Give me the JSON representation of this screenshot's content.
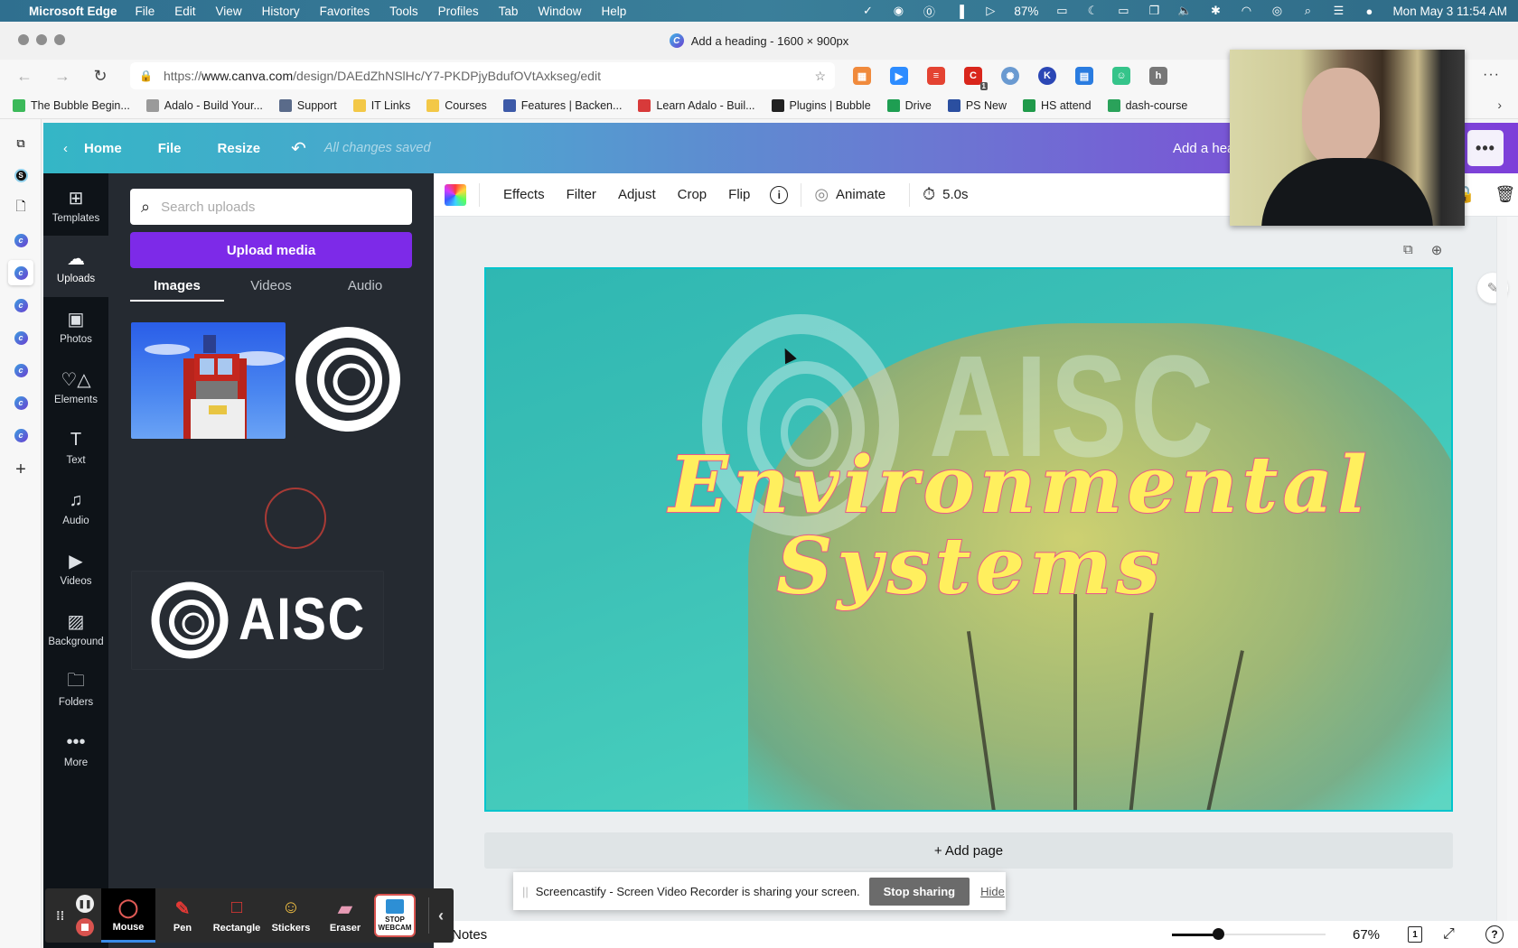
{
  "mac_menubar": {
    "app_name": "Microsoft Edge",
    "menus": [
      "File",
      "Edit",
      "View",
      "History",
      "Favorites",
      "Tools",
      "Profiles",
      "Tab",
      "Window",
      "Help"
    ],
    "battery": "87%",
    "clock": "Mon May 3  11:54 AM"
  },
  "window": {
    "title": "Add a heading - 1600 × 900px"
  },
  "browser": {
    "url_scheme": "https://",
    "url_host": "www.canva.com",
    "url_path": "/design/DAEdZhNSlHc/Y7-PKDPjyBdufOVtAxkseg/edit",
    "extension_badge": "1",
    "bookmarks": [
      {
        "label": "The Bubble Begin...",
        "color": "#3cb95a"
      },
      {
        "label": "Adalo - Build Your...",
        "color": "#9a9a9a"
      },
      {
        "label": "Support",
        "color": "#5a6b8a"
      },
      {
        "label": "IT Links",
        "color": "#f3c847"
      },
      {
        "label": "Courses",
        "color": "#f3c847"
      },
      {
        "label": "Features | Backen...",
        "color": "#3d5aa8"
      },
      {
        "label": "Learn Adalo - Buil...",
        "color": "#d83a3a"
      },
      {
        "label": "Plugins | Bubble",
        "color": "#222222"
      },
      {
        "label": "Drive",
        "color": "#1e9e52"
      },
      {
        "label": "PS New",
        "color": "#2b4fa0"
      },
      {
        "label": "HS attend",
        "color": "#1f9a4a"
      },
      {
        "label": "dash-course",
        "color": "#2aa25a"
      }
    ]
  },
  "canva_header": {
    "home": "Home",
    "file": "File",
    "resize": "Resize",
    "status": "All changes saved",
    "design_title": "Add a hea",
    "more": "•••"
  },
  "rail": {
    "items": [
      {
        "label": "Templates",
        "icon": "⊞"
      },
      {
        "label": "Uploads",
        "icon": "☁"
      },
      {
        "label": "Photos",
        "icon": "▣"
      },
      {
        "label": "Elements",
        "icon": "♡△"
      },
      {
        "label": "Text",
        "icon": "T"
      },
      {
        "label": "Audio",
        "icon": "♫"
      },
      {
        "label": "Videos",
        "icon": "▶"
      },
      {
        "label": "Background",
        "icon": "▨"
      },
      {
        "label": "Folders",
        "icon": "🗀"
      },
      {
        "label": "More",
        "icon": "•••"
      }
    ],
    "active": "Uploads"
  },
  "uploads_panel": {
    "search_placeholder": "Search uploads",
    "upload_button": "Upload media",
    "tabs": [
      "Images",
      "Videos",
      "Audio"
    ],
    "active_tab": "Images",
    "thumbnails": [
      "optimus-prime-image",
      "aisc-swirl-logo",
      "uploading-spinner",
      "aisc-logo-wordmark"
    ],
    "logo_text": "AISC"
  },
  "context_toolbar": {
    "buttons": [
      "Effects",
      "Filter",
      "Adjust",
      "Crop",
      "Flip"
    ],
    "animate": "Animate",
    "duration": "5.0s"
  },
  "design": {
    "heading_line1": "Environmental",
    "heading_line2": "Systems",
    "watermark_text": "AISC",
    "add_page": "+ Add page",
    "colors": {
      "heading_fill": "#ffef5e",
      "heading_stroke": "#e85c8a",
      "background": "#3cc0b6"
    }
  },
  "bottom_bar": {
    "notes": "Notes",
    "zoom_pct": "67%",
    "zoom_fraction": 0.3,
    "page_count": "1"
  },
  "share_banner": {
    "message": "Screencastify - Screen Video Recorder is sharing your screen.",
    "stop": "Stop sharing",
    "hide": "Hide"
  },
  "screencastify": {
    "tools": [
      {
        "label": "Mouse",
        "icon": "◯",
        "color": "#e05a55"
      },
      {
        "label": "Pen",
        "icon": "✎",
        "color": "#e53935"
      },
      {
        "label": "Rectangle",
        "icon": "□",
        "color": "#e53935"
      },
      {
        "label": "Stickers",
        "icon": "☺",
        "color": "#f6c343"
      },
      {
        "label": "Eraser",
        "icon": "▰",
        "color": "#e79bb5"
      }
    ],
    "active_tool": "Mouse",
    "stop_webcam_line1": "STOP",
    "stop_webcam_line2": "WEBCAM"
  }
}
